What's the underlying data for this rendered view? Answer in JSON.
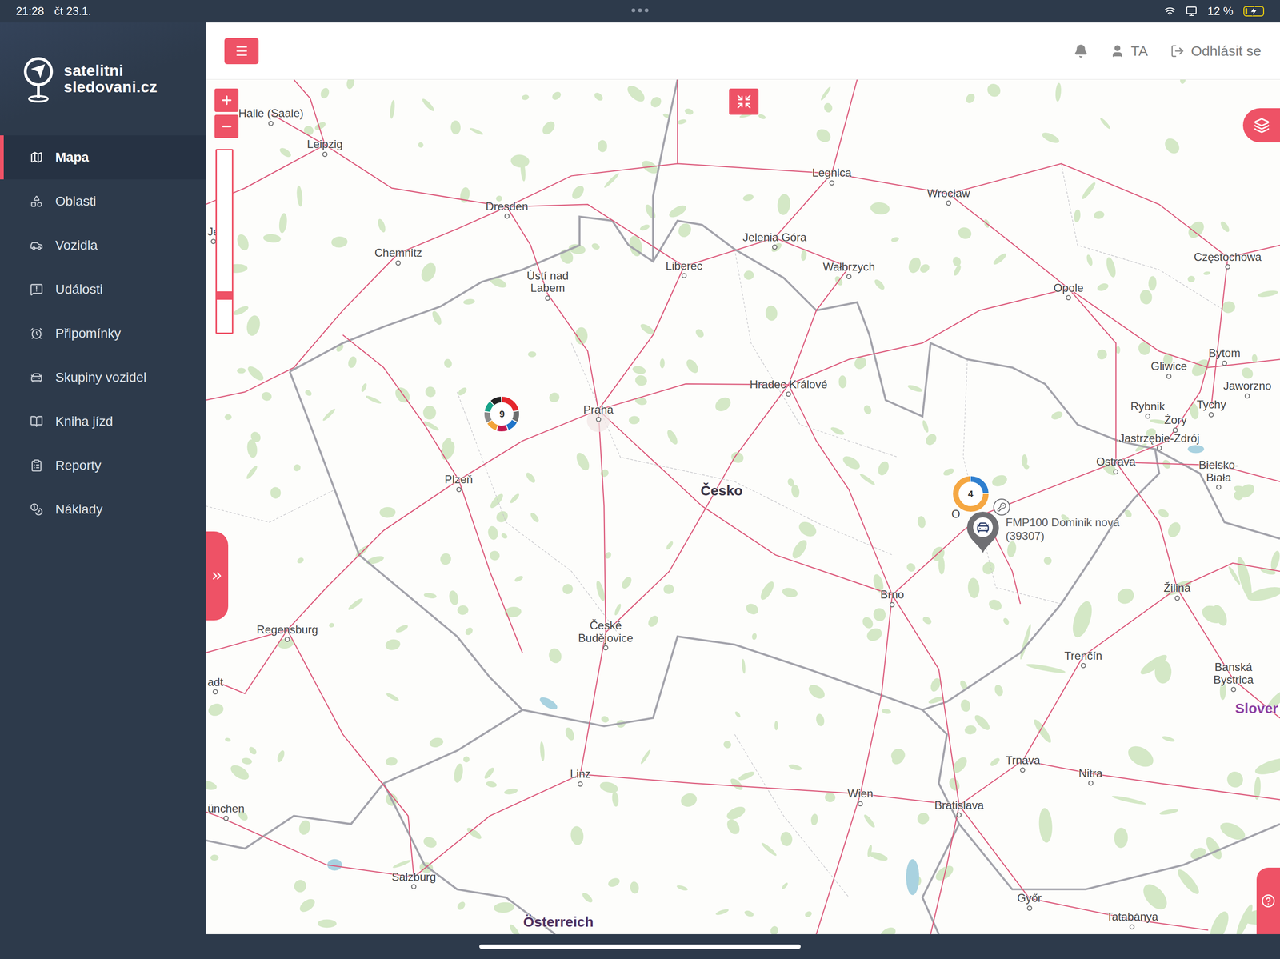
{
  "status_bar": {
    "time": "21:28",
    "date": "čt 23.1.",
    "battery_text": "12 %",
    "battery": {
      "level": 0.12,
      "charging": true
    }
  },
  "logo": {
    "line1": "satelitni",
    "line2": "sledovani.cz"
  },
  "sidebar": {
    "items": [
      {
        "label": "Mapa",
        "selected": true
      },
      {
        "label": "Oblasti",
        "selected": false
      },
      {
        "label": "Vozidla",
        "selected": false
      },
      {
        "label": "Události",
        "selected": false
      },
      {
        "label": "Připomínky",
        "selected": false
      },
      {
        "label": "Skupiny vozidel",
        "selected": false
      },
      {
        "label": "Kniha jízd",
        "selected": false
      },
      {
        "label": "Reporty",
        "selected": false
      },
      {
        "label": "Náklady",
        "selected": false
      }
    ]
  },
  "header": {
    "user": "TA",
    "logout": "Odhlásit se"
  },
  "map": {
    "zoom": {
      "level": 0.19
    },
    "labels": [
      {
        "text": "Halle (Saale)",
        "kind": "city"
      },
      {
        "text": "Leipzig",
        "kind": "city"
      },
      {
        "text": "Dresden",
        "kind": "city"
      },
      {
        "text": "Chemnitz",
        "kind": "city"
      },
      {
        "text": "Ústí nad\nLabem",
        "kind": "city"
      },
      {
        "text": "Liberec",
        "kind": "city"
      },
      {
        "text": "Jelenia Góra",
        "kind": "city"
      },
      {
        "text": "Legnica",
        "kind": "city"
      },
      {
        "text": "Wrocław",
        "kind": "city"
      },
      {
        "text": "Wałbrzych",
        "kind": "city"
      },
      {
        "text": "Opole",
        "kind": "city"
      },
      {
        "text": "Częstochowa",
        "kind": "city"
      },
      {
        "text": "Bytom",
        "kind": "city"
      },
      {
        "text": "Gliwice",
        "kind": "city"
      },
      {
        "text": "Jaworzno",
        "kind": "city"
      },
      {
        "text": "Tychy",
        "kind": "city"
      },
      {
        "text": "Rybnik",
        "kind": "city"
      },
      {
        "text": "Żory",
        "kind": "city"
      },
      {
        "text": "Jastrzębie-Zdrój",
        "kind": "city"
      },
      {
        "text": "Bielsko-Biała",
        "kind": "city"
      },
      {
        "text": "Ostrava",
        "kind": "city"
      },
      {
        "text": "Praha",
        "kind": "city"
      },
      {
        "text": "Hradec Králové",
        "kind": "city"
      },
      {
        "text": "Plzeň",
        "kind": "city"
      },
      {
        "text": "Česko",
        "kind": "country",
        "color": "#3b3546"
      },
      {
        "text": "Brno",
        "kind": "city"
      },
      {
        "text": "České\nBudějovice",
        "kind": "city"
      },
      {
        "text": "Regensburg",
        "kind": "city"
      },
      {
        "text": "Žilina",
        "kind": "city"
      },
      {
        "text": "Trenčín",
        "kind": "city"
      },
      {
        "text": "Banská\nBystrica",
        "kind": "city"
      },
      {
        "text": "Slover",
        "kind": "country",
        "color": "#8e3fa0"
      },
      {
        "text": "Linz",
        "kind": "city"
      },
      {
        "text": "Wien",
        "kind": "city"
      },
      {
        "text": "Bratislava",
        "kind": "city"
      },
      {
        "text": "Trnava",
        "kind": "city"
      },
      {
        "text": "Nitra",
        "kind": "city"
      },
      {
        "text": "Salzburg",
        "kind": "city"
      },
      {
        "text": "Österreich",
        "kind": "country",
        "color": "#4f3160"
      },
      {
        "text": "Győr",
        "kind": "city"
      },
      {
        "text": "Tatabánya",
        "kind": "city"
      },
      {
        "text": "Je",
        "kind": "city"
      },
      {
        "text": "adt",
        "kind": "city"
      },
      {
        "text": "ünchen",
        "kind": "city"
      },
      {
        "text": "O",
        "kind": "partial"
      }
    ],
    "clusters": [
      {
        "count": "9",
        "segments": [
          {
            "color": "#e4262c",
            "share": 0.222
          },
          {
            "color": "#6d6d6d",
            "share": 0.111
          },
          {
            "color": "#1f74c9",
            "share": 0.111
          },
          {
            "color": "#c2184e",
            "share": 0.111
          },
          {
            "color": "#f2a33a",
            "share": 0.111
          },
          {
            "color": "#8c8c8c",
            "share": 0.111
          },
          {
            "color": "#17a389",
            "share": 0.111
          },
          {
            "color": "#222222",
            "share": 0.112
          }
        ]
      },
      {
        "count": "4",
        "segments": [
          {
            "color": "#2f7fcf",
            "share": 0.25
          },
          {
            "color": "#f5a742",
            "share": 0.75
          }
        ]
      }
    ],
    "vehicle": {
      "name": "FMP100 Dominik nová",
      "id": "(39307)"
    }
  }
}
